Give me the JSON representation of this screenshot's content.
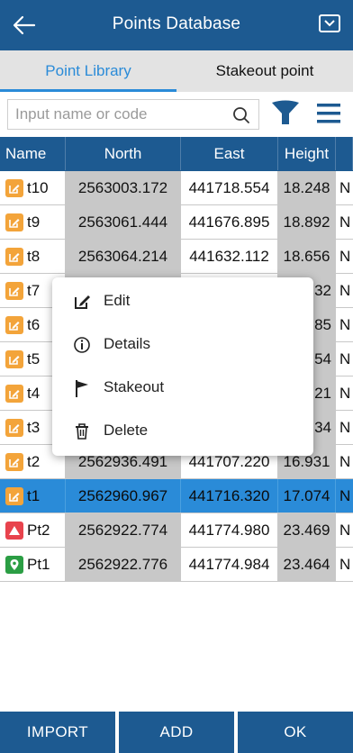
{
  "header": {
    "title": "Points Database"
  },
  "tabs": [
    {
      "label": "Point Library",
      "active": true
    },
    {
      "label": "Stakeout point",
      "active": false
    }
  ],
  "search": {
    "placeholder": "Input name or code",
    "value": ""
  },
  "table": {
    "columns": [
      "Name",
      "North",
      "East",
      "Height"
    ],
    "rows": [
      {
        "name": "t10",
        "north": "2563003.172",
        "east": "441718.554",
        "height": "18.248",
        "extra": "N",
        "type": "edit-icon",
        "selected": false
      },
      {
        "name": "t9",
        "north": "2563061.444",
        "east": "441676.895",
        "height": "18.892",
        "extra": "N",
        "type": "edit-icon",
        "selected": false
      },
      {
        "name": "t8",
        "north": "2563064.214",
        "east": "441632.112",
        "height": "18.656",
        "extra": "N",
        "type": "edit-icon",
        "selected": false
      },
      {
        "name": "t7",
        "north": "",
        "east": "",
        "height": "32",
        "extra": "N",
        "type": "edit-icon",
        "selected": false
      },
      {
        "name": "t6",
        "north": "",
        "east": "",
        "height": "85",
        "extra": "N",
        "type": "edit-icon",
        "selected": false
      },
      {
        "name": "t5",
        "north": "",
        "east": "",
        "height": "54",
        "extra": "N",
        "type": "edit-icon",
        "selected": false
      },
      {
        "name": "t4",
        "north": "",
        "east": "",
        "height": "21",
        "extra": "N",
        "type": "edit-icon",
        "selected": false
      },
      {
        "name": "t3",
        "north": "",
        "east": "",
        "height": "34",
        "extra": "N",
        "type": "edit-icon",
        "selected": false
      },
      {
        "name": "t2",
        "north": "2562936.491",
        "east": "441707.220",
        "height": "16.931",
        "extra": "N",
        "type": "edit-icon",
        "selected": false
      },
      {
        "name": "t1",
        "north": "2562960.967",
        "east": "441716.320",
        "height": "17.074",
        "extra": "N",
        "type": "edit-icon",
        "selected": true
      },
      {
        "name": "Pt2",
        "north": "2562922.774",
        "east": "441774.980",
        "height": "23.469",
        "extra": "N",
        "type": "stakeout-icon",
        "selected": false
      },
      {
        "name": "Pt1",
        "north": "2562922.776",
        "east": "441774.984",
        "height": "23.464",
        "extra": "N",
        "type": "location-pin-icon",
        "selected": false
      }
    ]
  },
  "context_menu": {
    "items": [
      {
        "label": "Edit",
        "icon": "edit-icon"
      },
      {
        "label": "Details",
        "icon": "details-icon"
      },
      {
        "label": "Stakeout",
        "icon": "flag-icon"
      },
      {
        "label": "Delete",
        "icon": "trash-icon"
      }
    ]
  },
  "footer": {
    "import_label": "IMPORT",
    "add_label": "ADD",
    "ok_label": "OK"
  },
  "colors": {
    "header": "#1d5a91",
    "accent": "#2a8bd8",
    "stripe": "#c8c8c8",
    "edit_badge": "#f3a43a",
    "stakeout_badge": "#e8434d",
    "point_badge": "#2b9e44"
  }
}
